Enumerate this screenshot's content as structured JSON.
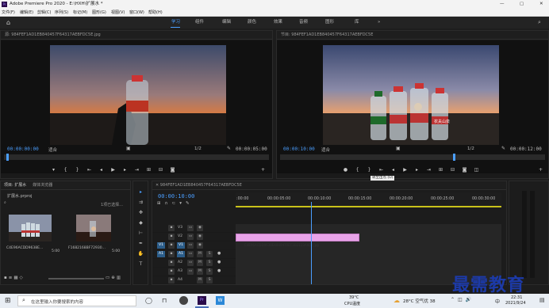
{
  "app": {
    "title": "Adobe Premiere Pro 2020 - E:\\HXH\\扩展水 *",
    "window_controls": [
      "—",
      "▢",
      "✕"
    ]
  },
  "menu": [
    "文件(F)",
    "编辑(E)",
    "剪辑(C)",
    "序列(S)",
    "标记(M)",
    "图形(G)",
    "视图(V)",
    "窗口(W)",
    "帮助(H)"
  ],
  "workspaces": {
    "items": [
      "学习",
      "组件",
      "编辑",
      "颜色",
      "效果",
      "音频",
      "图形",
      "库"
    ],
    "active": "学习",
    "more": "»"
  },
  "source_monitor": {
    "header": "源: 984FEF1AD1EB840457F64317AEBFDC5E.jpg",
    "timecode_in": "00:00:00:00",
    "fit": "适合",
    "ratio": "1/2",
    "timecode_out": "00:00:05:00"
  },
  "program_monitor": {
    "header": "节目: 984FEF1AD1EB840457F64317AEBFDC5E",
    "timecode_in": "00:00:10:00",
    "fit": "适合",
    "ratio": "1/2",
    "timecode_out": "00:00:12:00",
    "tooltip": "转至出点 (O)",
    "bottle_label": "农夫山泉"
  },
  "project": {
    "tabs": [
      "项目: 扩展水",
      "媒体浏览器"
    ],
    "file": "扩展水.prproj",
    "count": "1项已选择...",
    "items": [
      {
        "name": "C4E96ACDD9638E...",
        "duration": "5:00"
      },
      {
        "name": "F1682168BF72930...",
        "duration": "5:00"
      }
    ]
  },
  "timeline": {
    "tab": "984FEF1AD1EB840457F64317AEBFDC5E",
    "timecode": "00:00:10:00",
    "ruler": [
      ":00:00",
      "00:00:05:00",
      "00:00:10:00",
      "00:00:15:00",
      "00:00:20:00",
      "00:00:25:00",
      "00:00:30:00"
    ],
    "tracks": [
      "V3",
      "V2",
      "V1",
      "A1",
      "A2",
      "A3",
      "A4"
    ],
    "track_labels": {
      "v1": "V1",
      "a1": "A1"
    },
    "clip": "C4E96ACDD9638E4840470EC3B2123A600.jpg",
    "playhead_fraction": 0.285
  },
  "taskbar": {
    "search_placeholder": "在这里输入你要搜索的内容",
    "cpu_temp": "39°C",
    "cpu_label": "CPU温度",
    "weather": "28°C 空气优 38",
    "time": "22:31",
    "date": "2021/9/24",
    "lang": "中"
  },
  "watermark": "最需教育",
  "colors": {
    "accent": "#4a9eff",
    "clip": "#e8a3e8",
    "timecode": "#4a9eff"
  }
}
